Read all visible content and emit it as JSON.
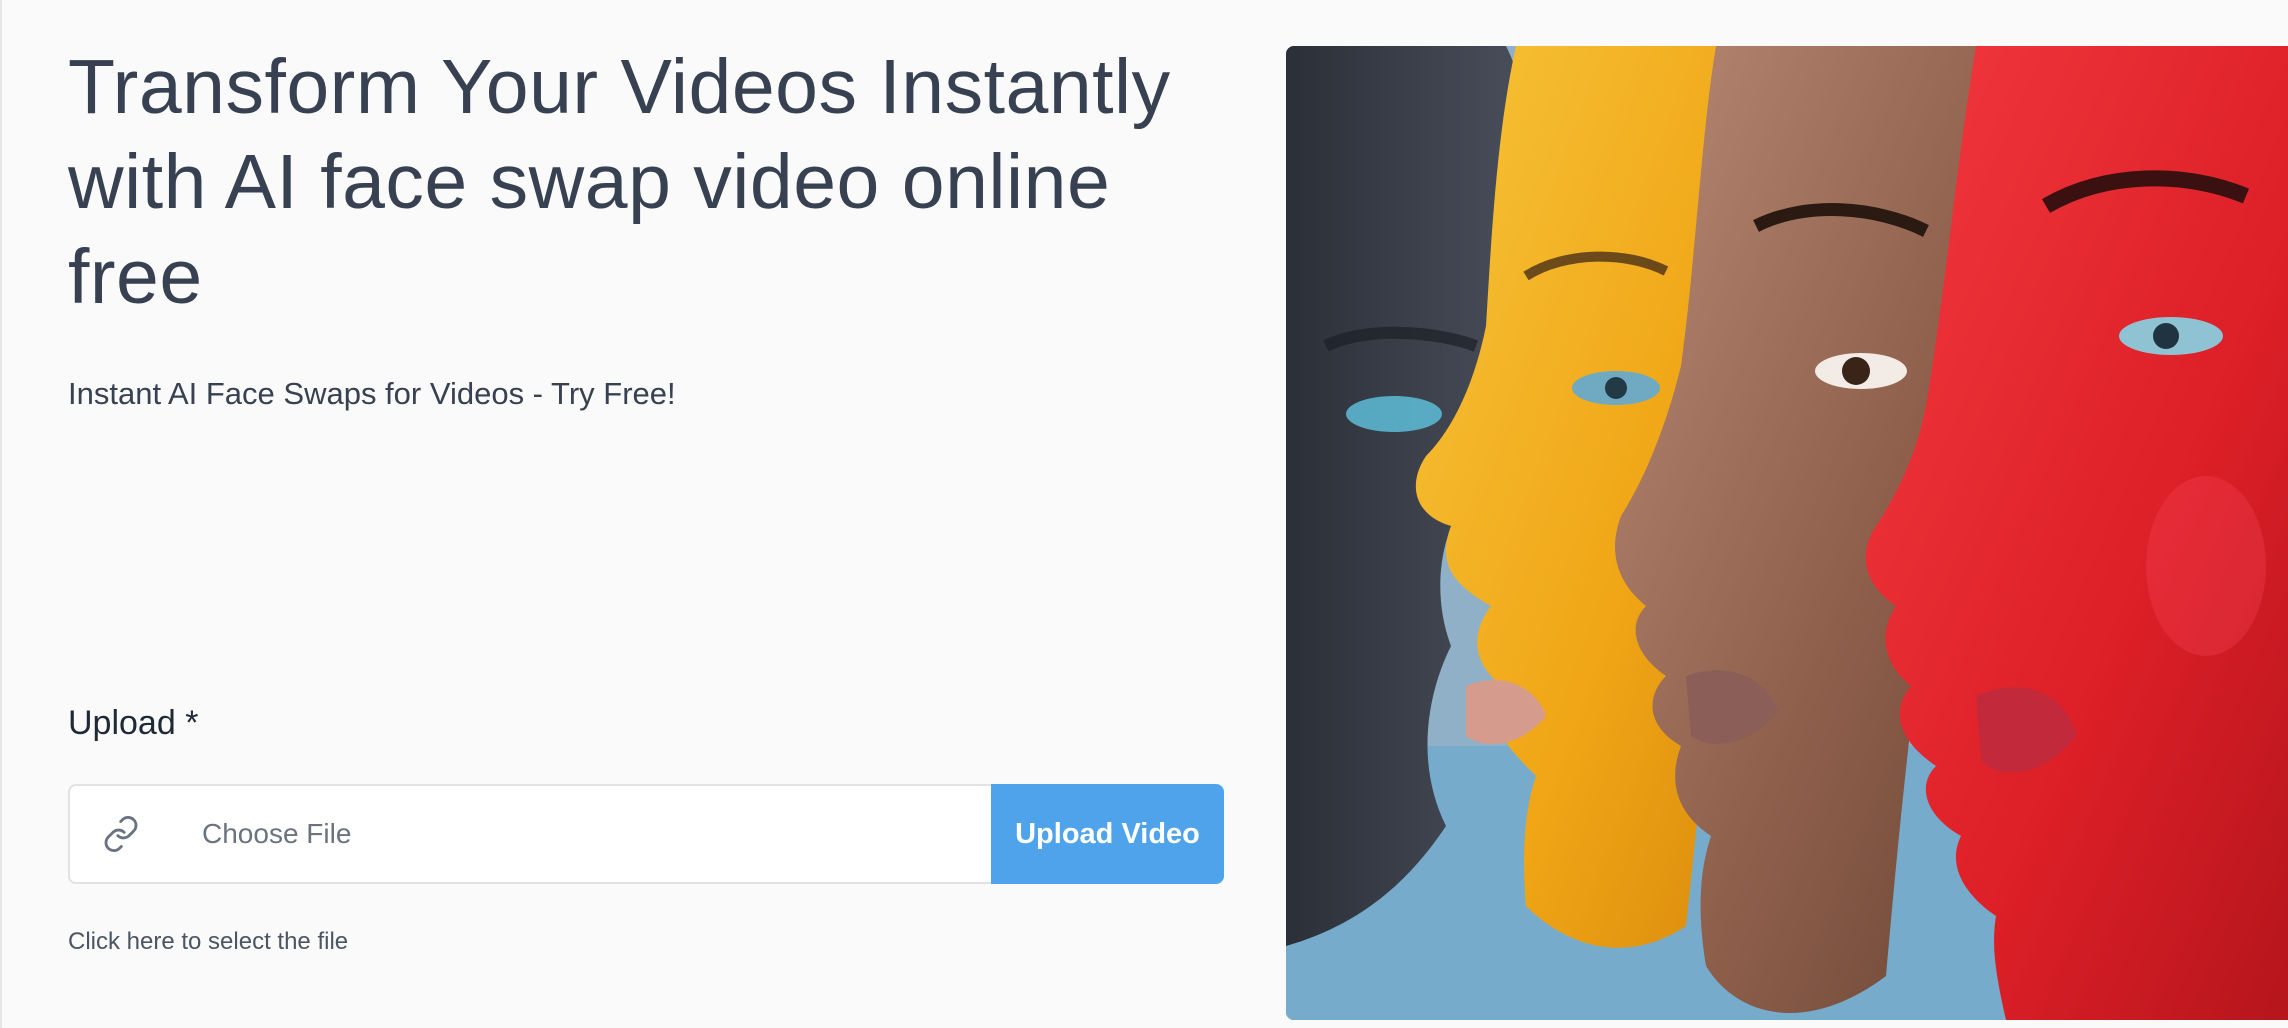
{
  "hero": {
    "title": "Transform Your Videos Instantly with AI face swap video online free",
    "subtitle": "Instant AI Face Swaps for Videos - Try Free!"
  },
  "upload": {
    "label": "Upload *",
    "file_placeholder": "Choose File",
    "button_label": "Upload Video",
    "helper_text": "Click here to select the file",
    "icon": "link-icon"
  },
  "image": {
    "subject": "four painted faces in profile",
    "face_colors": [
      "#3a3d47",
      "#f2b11e",
      "#9a6a55",
      "#e5252c"
    ]
  },
  "colors": {
    "accent": "#4fa3ea",
    "text": "#374151",
    "background": "#fafafa"
  }
}
